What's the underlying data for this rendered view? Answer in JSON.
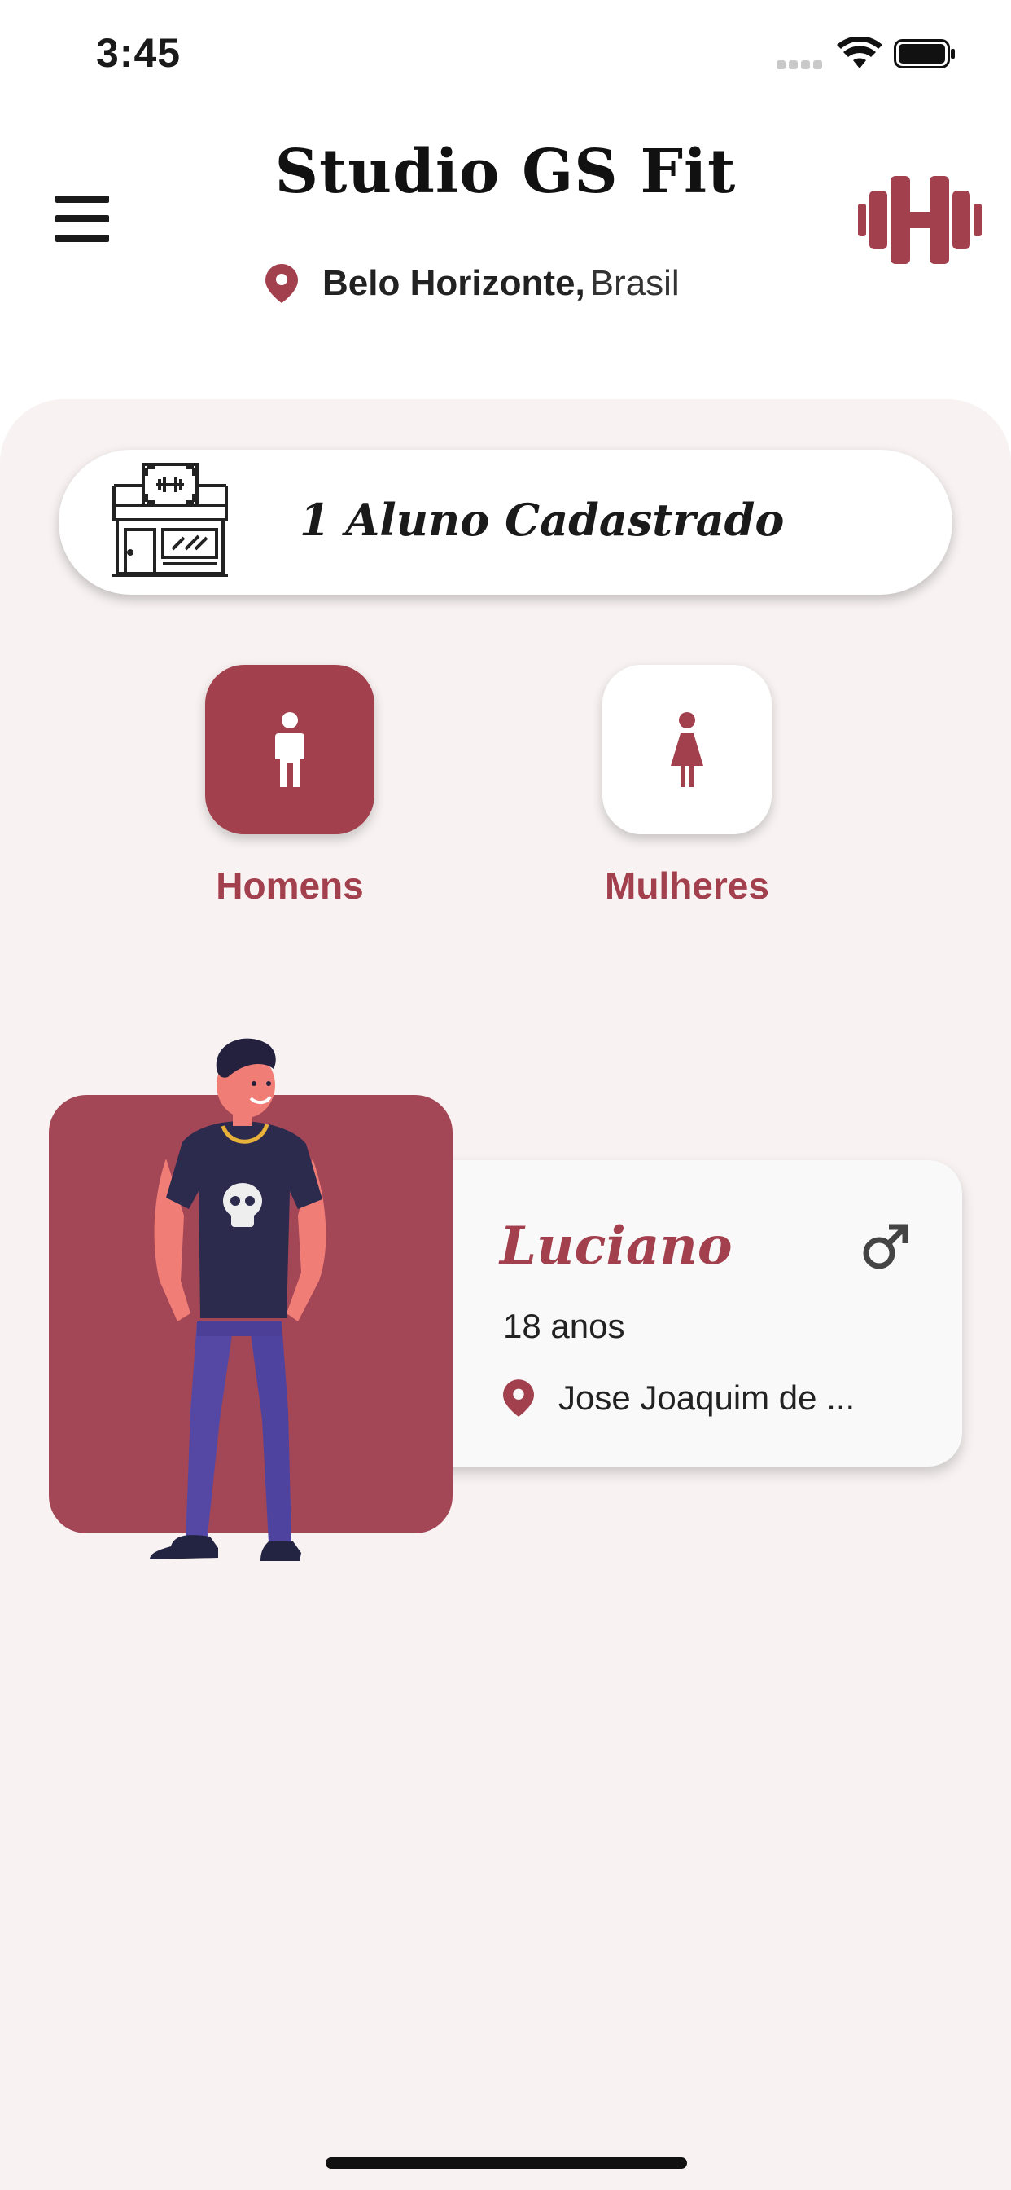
{
  "status_bar": {
    "time": "3:45"
  },
  "header": {
    "title": "Studio GS Fit",
    "location_city": "Belo Horizonte,",
    "location_country": "Brasil"
  },
  "summary": {
    "count_text": "1 Aluno Cadastrado"
  },
  "filters": {
    "men_label": "Homens",
    "women_label": "Mulheres"
  },
  "students": [
    {
      "name": "Luciano",
      "age": "18 anos",
      "address": "Jose Joaquim de ...",
      "gender_icon": "male-icon"
    }
  ],
  "colors": {
    "accent": "#a3404e",
    "panel_bg": "#f8f2f2",
    "card_bg": "#ffffff"
  }
}
